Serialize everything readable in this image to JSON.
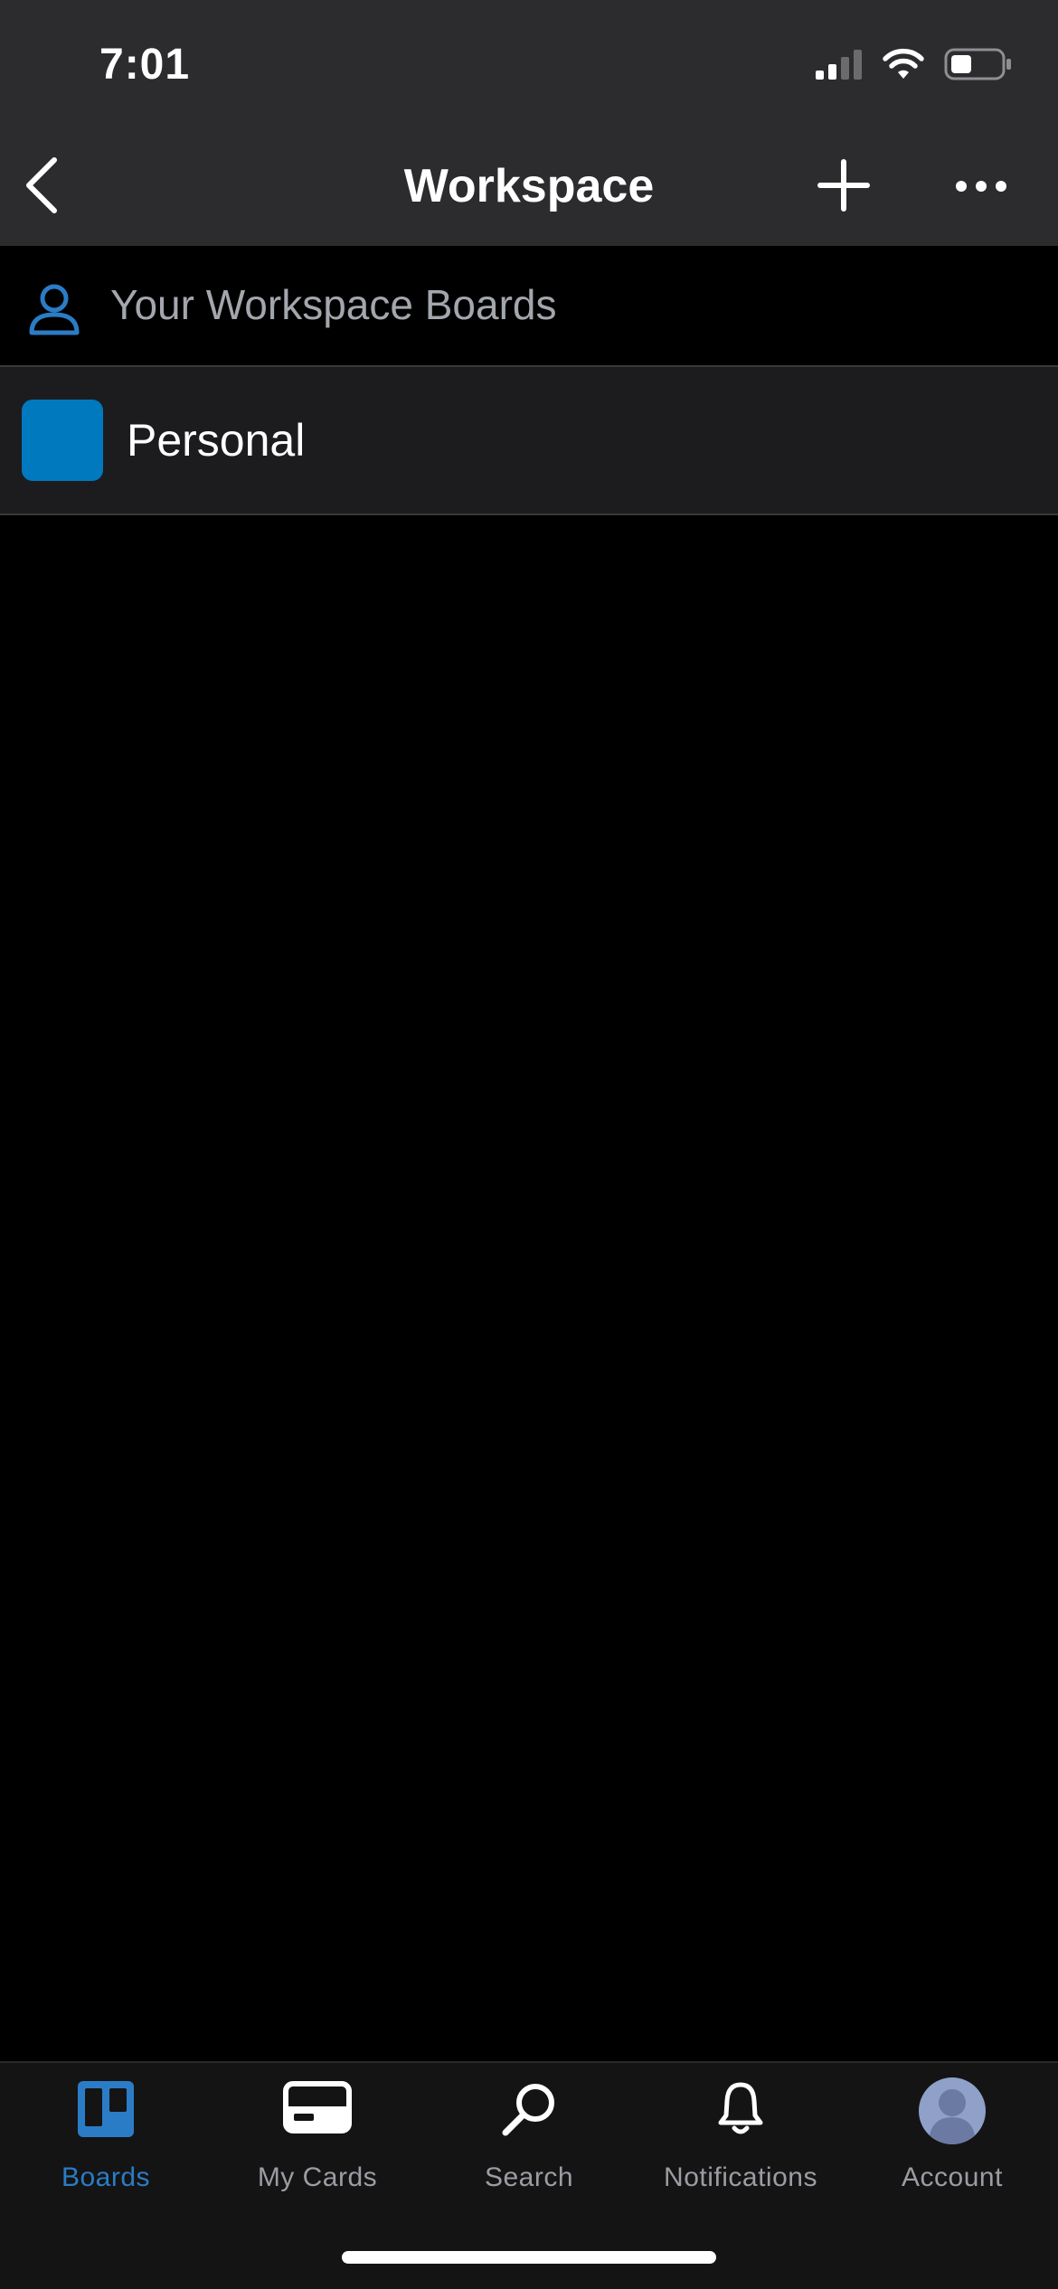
{
  "status_bar": {
    "time": "7:01",
    "icons": [
      "signal-icon",
      "wifi-icon",
      "battery-icon"
    ]
  },
  "nav": {
    "title": "Workspace",
    "back_icon": "chevron-left-icon",
    "add_icon": "plus-icon",
    "more_icon": "ellipsis-icon"
  },
  "section": {
    "icon": "person-icon",
    "label": "Your Workspace Boards"
  },
  "boards": [
    {
      "name": "Personal",
      "color": "#0079bf"
    }
  ],
  "tabs": [
    {
      "label": "Boards",
      "icon": "boards-icon",
      "active": true
    },
    {
      "label": "My Cards",
      "icon": "cards-icon",
      "active": false
    },
    {
      "label": "Search",
      "icon": "search-icon",
      "active": false
    },
    {
      "label": "Notifications",
      "icon": "bell-icon",
      "active": false
    },
    {
      "label": "Account",
      "icon": "avatar-icon",
      "active": false
    }
  ],
  "colors": {
    "accent": "#2b7cc6",
    "topbar": "#2c2c2e",
    "row_bg": "#1c1c1e"
  }
}
